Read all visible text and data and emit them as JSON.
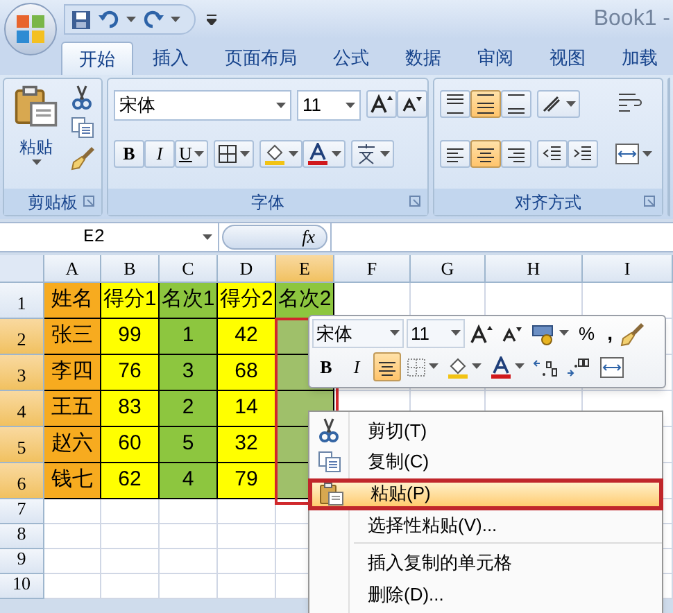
{
  "title_bar": {
    "title": "Book1 -"
  },
  "tabs": [
    {
      "label": "开始",
      "selected": true
    },
    {
      "label": "插入",
      "selected": false
    },
    {
      "label": "页面布局",
      "selected": false
    },
    {
      "label": "公式",
      "selected": false
    },
    {
      "label": "数据",
      "selected": false
    },
    {
      "label": "审阅",
      "selected": false
    },
    {
      "label": "视图",
      "selected": false
    },
    {
      "label": "加载",
      "selected": false
    }
  ],
  "ribbon": {
    "clipboard": {
      "label": "剪贴板",
      "paste_label": "粘贴"
    },
    "font": {
      "label": "字体",
      "font_name": "宋体",
      "font_size": "11",
      "style_buttons": [
        "B",
        "I",
        "U"
      ]
    },
    "alignment": {
      "label": "对齐方式",
      "vertical": [
        {
          "selected": false
        },
        {
          "selected": true
        },
        {
          "selected": false
        }
      ],
      "horizontal": [
        {
          "selected": false
        },
        {
          "selected": true
        },
        {
          "selected": false
        }
      ]
    }
  },
  "formula_bar": {
    "name_box": "E2",
    "function_label": "fx"
  },
  "sheet": {
    "columns": [
      {
        "label": "A",
        "selected": false
      },
      {
        "label": "B",
        "selected": false
      },
      {
        "label": "C",
        "selected": false
      },
      {
        "label": "D",
        "selected": false
      },
      {
        "label": "E",
        "selected": true
      },
      {
        "label": "F",
        "selected": false
      },
      {
        "label": "G",
        "selected": false
      },
      {
        "label": "H",
        "selected": false
      },
      {
        "label": "I",
        "selected": false
      }
    ],
    "rows": [
      {
        "header": "1",
        "selected": false,
        "cells": [
          {
            "text": "姓名",
            "color": "#f7ab1f"
          },
          {
            "text": "得分1",
            "color": "#ffff00"
          },
          {
            "text": "名次1",
            "color": "#8dc63f"
          },
          {
            "text": "得分2",
            "color": "#ffff00"
          },
          {
            "text": "名次2",
            "color": "#8dc63f"
          }
        ]
      },
      {
        "header": "2",
        "selected": true,
        "cells": [
          {
            "text": "张三",
            "color": "#f7ab1f"
          },
          {
            "text": "99",
            "color": "#ffff00"
          },
          {
            "text": "1",
            "color": "#8dc63f"
          },
          {
            "text": "42",
            "color": "#ffff00"
          },
          {
            "color": "#9fc06a"
          }
        ]
      },
      {
        "header": "3",
        "selected": true,
        "cells": [
          {
            "text": "李四",
            "color": "#f7ab1f"
          },
          {
            "text": "76",
            "color": "#ffff00"
          },
          {
            "text": "3",
            "color": "#8dc63f"
          },
          {
            "text": "68",
            "color": "#ffff00"
          },
          {
            "color": "#9fc06a"
          }
        ]
      },
      {
        "header": "4",
        "selected": true,
        "cells": [
          {
            "text": "王五",
            "color": "#f7ab1f"
          },
          {
            "text": "83",
            "color": "#ffff00"
          },
          {
            "text": "2",
            "color": "#8dc63f"
          },
          {
            "text": "14",
            "color": "#ffff00"
          },
          {
            "color": "#9fc06a"
          }
        ]
      },
      {
        "header": "5",
        "selected": true,
        "cells": [
          {
            "text": "赵六",
            "color": "#f7ab1f"
          },
          {
            "text": "60",
            "color": "#ffff00"
          },
          {
            "text": "5",
            "color": "#8dc63f"
          },
          {
            "text": "32",
            "color": "#ffff00"
          },
          {
            "color": "#9fc06a"
          }
        ]
      },
      {
        "header": "6",
        "selected": true,
        "cells": [
          {
            "text": "钱七",
            "color": "#f7ab1f"
          },
          {
            "text": "62",
            "color": "#ffff00"
          },
          {
            "text": "4",
            "color": "#8dc63f"
          },
          {
            "text": "79",
            "color": "#ffff00"
          },
          {
            "color": "#9fc06a"
          }
        ]
      },
      {
        "header": "7",
        "selected": false
      },
      {
        "header": "8",
        "selected": false
      },
      {
        "header": "9",
        "selected": false
      },
      {
        "header": "10",
        "selected": false
      }
    ]
  },
  "mini_toolbar": {
    "font_name": "宋体",
    "font_size": "11",
    "percent": "%",
    "comma": ",",
    "bold": "B",
    "italic": "I",
    "center_selected": true
  },
  "context_menu": {
    "items": [
      {
        "kind": "cut",
        "label": "剪切(T)",
        "selected": false
      },
      {
        "kind": "copy",
        "label": "复制(C)",
        "selected": false
      },
      {
        "kind": "paste",
        "label": "粘贴(P)",
        "selected": true
      },
      {
        "kind": "plain",
        "label": "选择性粘贴(V)...",
        "selected": false
      },
      {
        "kind": "separator"
      },
      {
        "kind": "plain",
        "label": "插入复制的单元格",
        "selected": false
      },
      {
        "kind": "plain",
        "label": "删除(D)...",
        "selected": false
      }
    ]
  }
}
